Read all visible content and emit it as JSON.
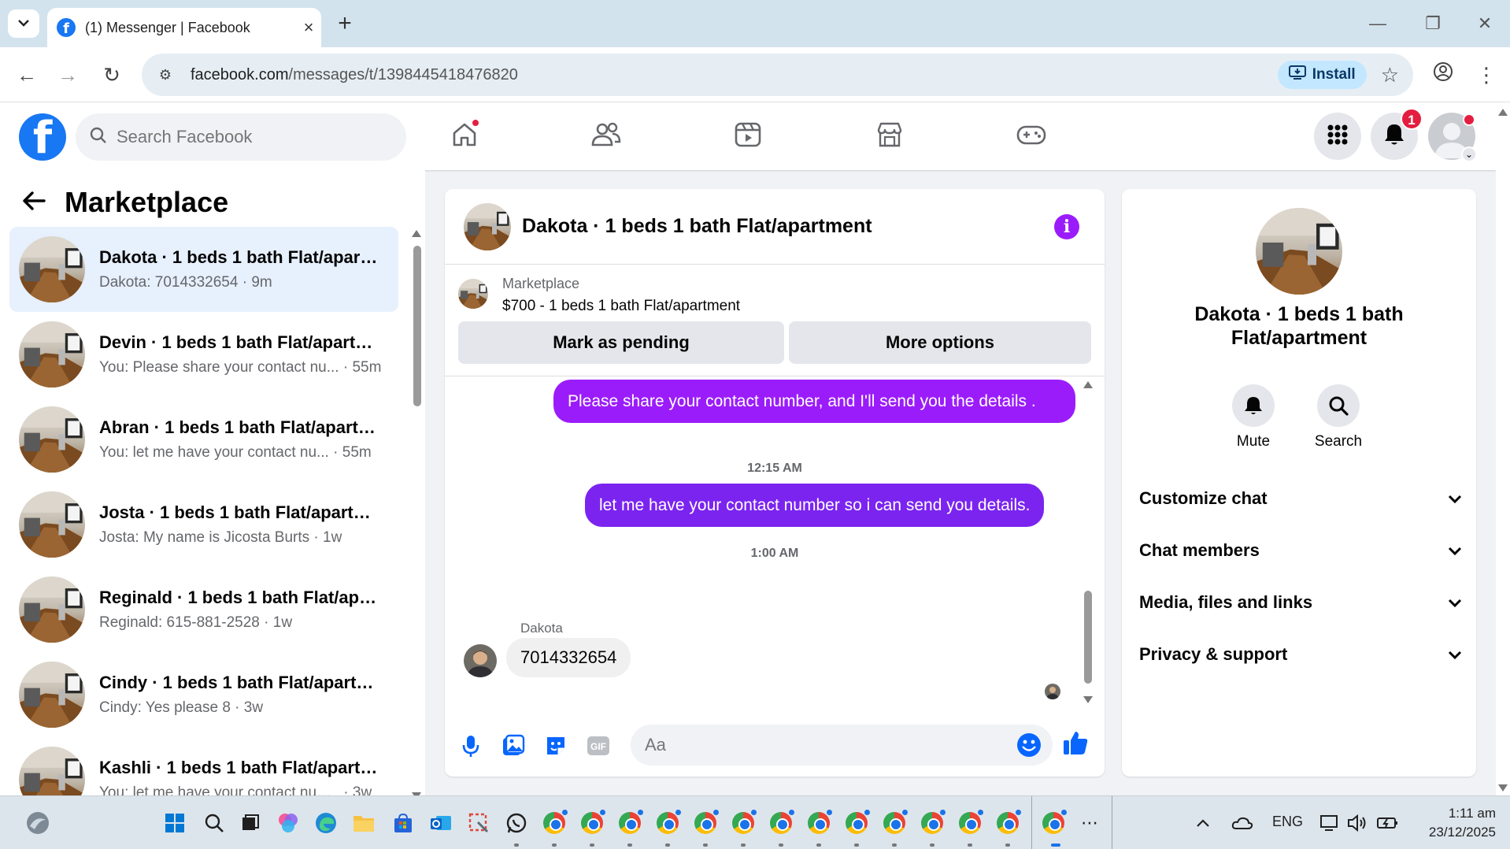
{
  "browser": {
    "tab_title": "(1) Messenger | Facebook",
    "url_host": "facebook.com",
    "url_path": "/messages/t/1398445418476820",
    "install_label": "Install"
  },
  "fb_header": {
    "search_placeholder": "Search Facebook",
    "notifications_count": "1"
  },
  "sidebar": {
    "title": "Marketplace",
    "conversations": [
      {
        "name": "Dakota · 1 beds 1 bath Flat/apartment",
        "preview": "Dakota: 7014332654",
        "time": "9m",
        "active": true
      },
      {
        "name": "Devin · 1 beds 1 bath Flat/apartment",
        "preview": "You: Please share your contact nu...",
        "time": "55m"
      },
      {
        "name": "Abran · 1 beds 1 bath Flat/apartment",
        "preview": "You: let me have your contact nu...",
        "time": "55m"
      },
      {
        "name": "Josta · 1 beds 1 bath Flat/apartment",
        "preview": "Josta: My name is Jicosta Burts",
        "time": "1w"
      },
      {
        "name": "Reginald · 1 beds 1 bath Flat/apartment",
        "preview": "Reginald: 615-881-2528",
        "time": "1w"
      },
      {
        "name": "Cindy · 1 beds 1 bath Flat/apartment",
        "preview": "Cindy: Yes please 8",
        "time": "3w"
      },
      {
        "name": "Kashli · 1 beds 1 bath Flat/apartment",
        "preview": "You: let me have your contact num...",
        "time": "3w"
      }
    ]
  },
  "chat": {
    "title": "Dakota · 1 beds 1 bath Flat/apartment",
    "listing_label": "Marketplace",
    "listing_price": "$700 - 1 beds 1 bath Flat/apartment",
    "mark_pending_label": "Mark as pending",
    "more_options_label": "More options",
    "msg_out_1": "Please share your contact number, and I'll send you the details .",
    "ts_1": "12:15 AM",
    "msg_out_2": "let me have your contact number so i can send you details.",
    "ts_2": "1:00 AM",
    "sender_name": "Dakota",
    "msg_in_1": "7014332654",
    "composer_placeholder": "Aa"
  },
  "details": {
    "title": "Dakota · 1 beds 1 bath Flat/apartment",
    "mute_label": "Mute",
    "search_label": "Search",
    "sections": [
      "Customize chat",
      "Chat members",
      "Media, files and links",
      "Privacy & support"
    ]
  },
  "taskbar": {
    "lang": "ENG",
    "time": "1:11 am",
    "date": "23/12/2025"
  },
  "colors": {
    "accent": "#9b1cfa",
    "facebook_blue": "#1877f2",
    "badge_red": "#e41e3f"
  }
}
